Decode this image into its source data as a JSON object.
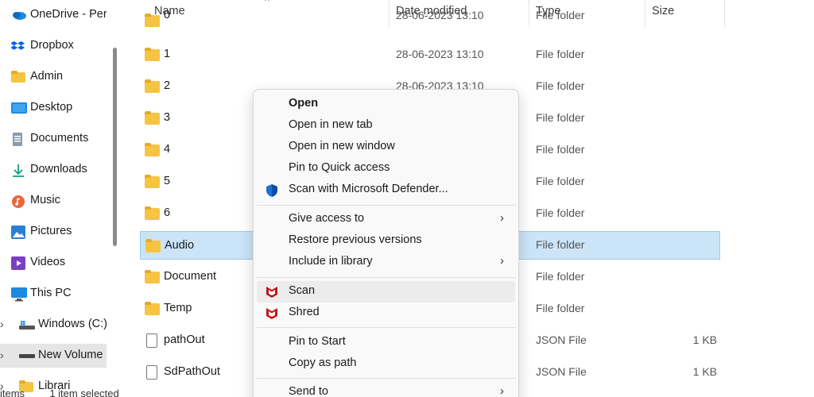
{
  "sidebar": {
    "items": [
      {
        "label": "OneDrive - Per",
        "icon": "onedrive-icon"
      },
      {
        "label": "Dropbox",
        "icon": "dropbox-icon"
      },
      {
        "label": "Admin",
        "icon": "folder-icon"
      },
      {
        "label": "Desktop",
        "icon": "desktop-icon"
      },
      {
        "label": "Documents",
        "icon": "documents-icon"
      },
      {
        "label": "Downloads",
        "icon": "download-icon"
      },
      {
        "label": "Music",
        "icon": "music-icon"
      },
      {
        "label": "Pictures",
        "icon": "pictures-icon"
      },
      {
        "label": "Videos",
        "icon": "videos-icon"
      },
      {
        "label": "This PC",
        "icon": "computer-icon"
      },
      {
        "label": "Windows (C:)",
        "icon": "drive-icon"
      },
      {
        "label": "New Volume",
        "icon": "drive-icon"
      },
      {
        "label": "Librari",
        "icon": "library-icon"
      }
    ],
    "selected": "New Volume"
  },
  "columns": {
    "name": "Name",
    "date": "Date modified",
    "type": "Type",
    "size": "Size"
  },
  "rows": [
    {
      "name": "0",
      "date": "28-06-2023 13:10",
      "type": "File folder",
      "size": "",
      "kind": "folder"
    },
    {
      "name": "1",
      "date": "28-06-2023 13:10",
      "type": "File folder",
      "size": "",
      "kind": "folder"
    },
    {
      "name": "2",
      "date": "28-06-2023 13:10",
      "type": "File folder",
      "size": "",
      "kind": "folder"
    },
    {
      "name": "3",
      "date": "",
      "type": "File folder",
      "size": "",
      "kind": "folder"
    },
    {
      "name": "4",
      "date": "",
      "type": "File folder",
      "size": "",
      "kind": "folder"
    },
    {
      "name": "5",
      "date": "",
      "type": "File folder",
      "size": "",
      "kind": "folder"
    },
    {
      "name": "6",
      "date": "",
      "type": "File folder",
      "size": "",
      "kind": "folder"
    },
    {
      "name": "Audio",
      "date": "",
      "type": "File folder",
      "size": "",
      "kind": "folder"
    },
    {
      "name": "Document",
      "date": "",
      "type": "File folder",
      "size": "",
      "kind": "folder"
    },
    {
      "name": "Temp",
      "date": "",
      "type": "File folder",
      "size": "",
      "kind": "folder"
    },
    {
      "name": "pathOut",
      "date": "",
      "type": "JSON File",
      "size": "1 KB",
      "kind": "file"
    },
    {
      "name": "SdPathOut",
      "date": "",
      "type": "JSON File",
      "size": "1 KB",
      "kind": "file"
    }
  ],
  "selected_row": "Audio",
  "context_menu": {
    "group1": [
      {
        "label": "Open",
        "bold": true
      },
      {
        "label": "Open in new tab"
      },
      {
        "label": "Open in new window"
      },
      {
        "label": "Pin to Quick access"
      },
      {
        "label": "Scan with Microsoft Defender...",
        "icon": "defender-shield-icon"
      }
    ],
    "group2": [
      {
        "label": "Give access to",
        "submenu": true
      },
      {
        "label": "Restore previous versions"
      },
      {
        "label": "Include in library",
        "submenu": true
      }
    ],
    "group3": [
      {
        "label": "Scan",
        "icon": "mcafee-icon",
        "hovered": true
      },
      {
        "label": "Shred",
        "icon": "mcafee-icon"
      }
    ],
    "group4": [
      {
        "label": "Pin to Start"
      },
      {
        "label": "Copy as path"
      },
      {
        "label": "Send to",
        "submenu": true
      }
    ],
    "submenu_arrow": "›"
  },
  "status_bar": {
    "items": "items",
    "selected": "1 item selected"
  },
  "colors": {
    "folder": "#f5c443",
    "selection": "#cce4f7",
    "defender": "#1e6fd0",
    "mcafee": "#c01818"
  }
}
